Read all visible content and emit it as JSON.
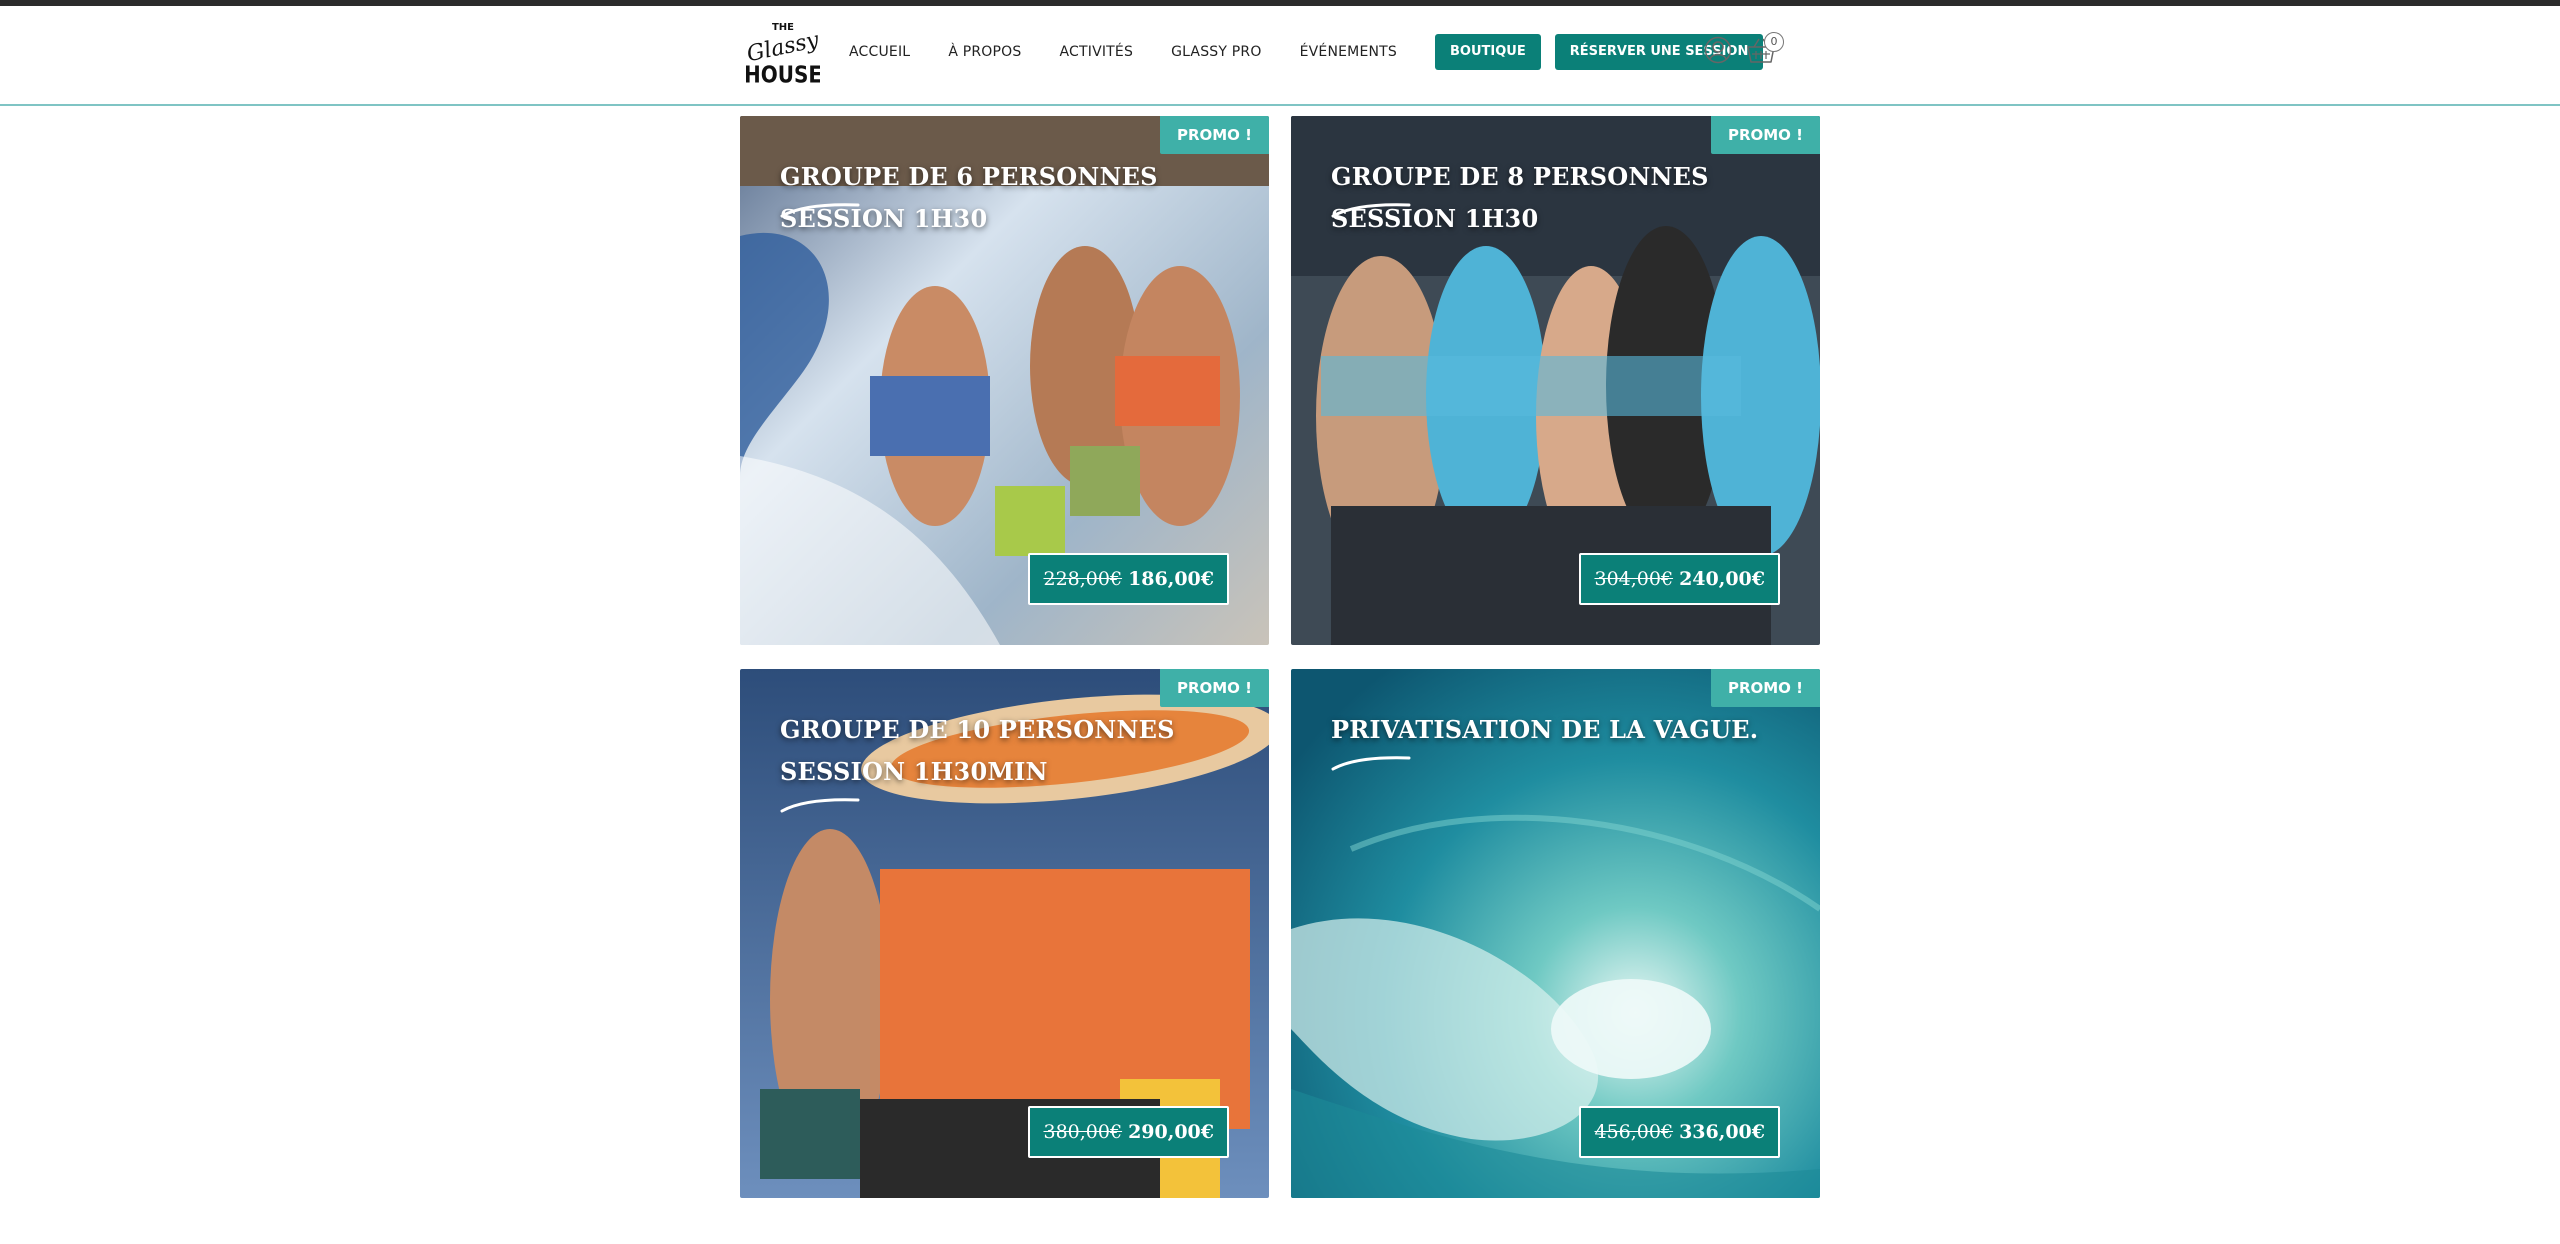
{
  "nav": {
    "items": [
      "Accueil",
      "À propos",
      "Activités",
      "Glassy pro",
      "Événements"
    ],
    "boutique": "Boutique",
    "reserve": "Réserver une session"
  },
  "cart": {
    "count": "0"
  },
  "products": [
    {
      "badge": "PROMO !",
      "title": "GROUPE DE 6 PERSONNES SESSION 1H30",
      "old_price": "228,00€",
      "new_price": "186,00€"
    },
    {
      "badge": "PROMO !",
      "title": "GROUPE DE 8 PERSONNES SESSION 1H30",
      "old_price": "304,00€",
      "new_price": "240,00€"
    },
    {
      "badge": "PROMO !",
      "title": "GROUPE DE 10 PERSONNES SESSION 1H30MIN",
      "old_price": "380,00€",
      "new_price": "290,00€"
    },
    {
      "badge": "PROMO !",
      "title": "PRIVATISATION DE LA VAGUE.",
      "old_price": "456,00€",
      "new_price": "336,00€"
    }
  ],
  "icons": {
    "user": "user-icon",
    "cart": "shopping-basket-icon"
  },
  "colors": {
    "accent": "#0b8078",
    "badge": "#3fb0a8"
  }
}
